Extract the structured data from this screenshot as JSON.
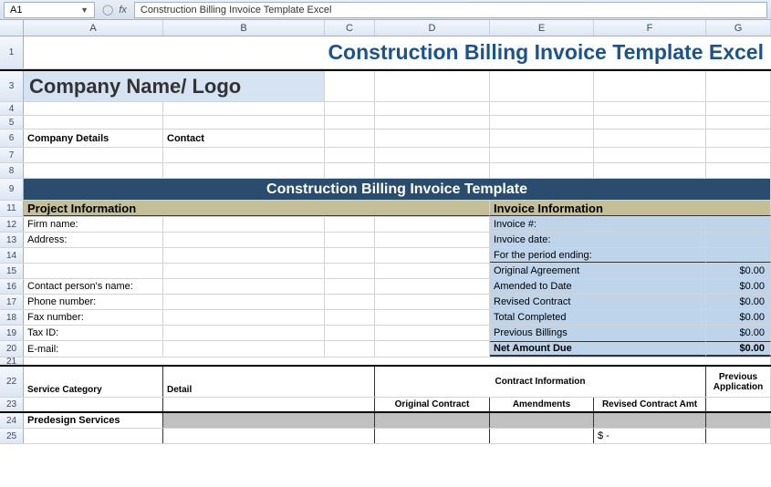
{
  "formulaBar": {
    "cellRef": "A1",
    "fx": "fx",
    "content": "Construction Billing Invoice Template Excel"
  },
  "columns": [
    "A",
    "B",
    "C",
    "D",
    "E",
    "F",
    "G"
  ],
  "rows": [
    "1",
    "3",
    "4",
    "5",
    "6",
    "7",
    "8",
    "9",
    "11",
    "12",
    "13",
    "14",
    "15",
    "16",
    "17",
    "18",
    "19",
    "20",
    "21",
    "22",
    "23",
    "24",
    "25"
  ],
  "title": "Construction Billing Invoice Template Excel",
  "companyLogo": "Company Name/ Logo",
  "companyDetails": "Company Details",
  "contact": "Contact",
  "banner": "Construction Billing Invoice Template",
  "sections": {
    "projectInfo": "Project Information",
    "invoiceInfo": "Invoice Information"
  },
  "projectFields": {
    "firmName": "Firm name:",
    "address": "Address:",
    "contactPerson": "Contact person's name:",
    "phone": "Phone number:",
    "fax": "Fax number:",
    "taxId": "Tax ID:",
    "email": "E-mail:"
  },
  "invoiceFields": {
    "invoiceNum": "Invoice #:",
    "invoiceDate": "Invoice date:",
    "periodEnding": "For the period ending:",
    "originalAgreement": "Original Agreement",
    "amendedToDate": "Amended to Date",
    "revisedContract": "Revised Contract",
    "totalCompleted": "Total Completed",
    "previousBillings": "Previous Billings",
    "netAmountDue": "Net Amount Due"
  },
  "amounts": {
    "originalAgreement": "$0.00",
    "amendedToDate": "$0.00",
    "revisedContract": "$0.00",
    "totalCompleted": "$0.00",
    "previousBillings": "$0.00",
    "netAmountDue": "$0.00"
  },
  "tableHeaders": {
    "serviceCategory": "Service Category",
    "detail": "Detail",
    "contractInfo": "Contract Information",
    "previousApp": "Previous Application",
    "originalContract": "Original Contract",
    "amendments": "Amendments",
    "revisedContractAmt": "Revised Contract Amt"
  },
  "tableRows": {
    "predesign": "Predesign Services",
    "dollarDash": "$                    -"
  }
}
